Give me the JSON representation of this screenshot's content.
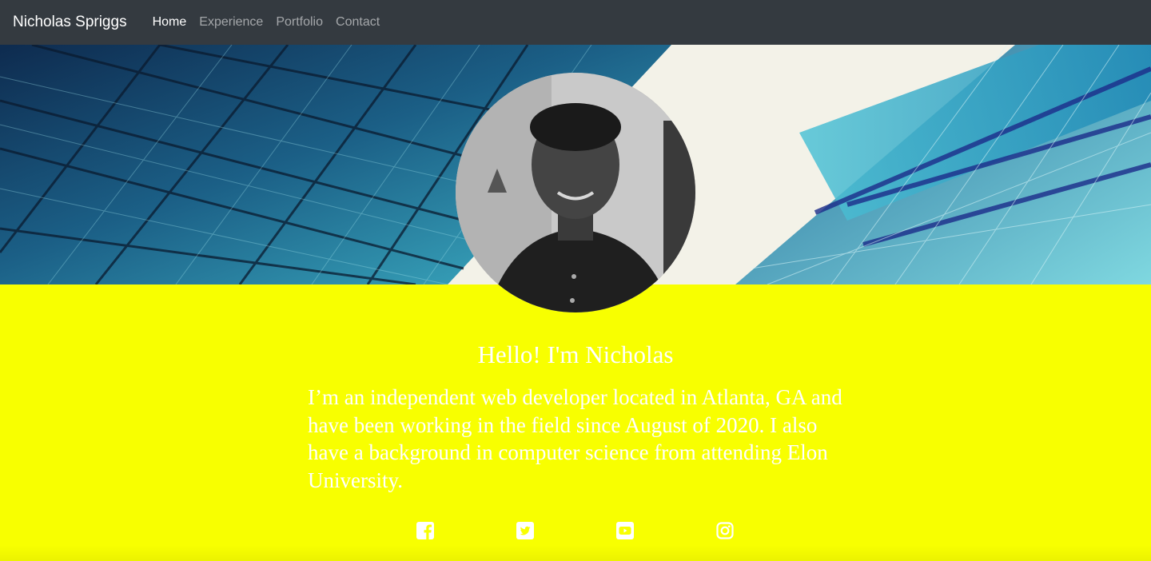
{
  "navbar": {
    "brand": "Nicholas Spriggs",
    "links": [
      {
        "label": "Home",
        "active": true
      },
      {
        "label": "Experience",
        "active": false
      },
      {
        "label": "Portfolio",
        "active": false
      },
      {
        "label": "Contact",
        "active": false
      }
    ]
  },
  "hero": {
    "greeting": "Hello! I'm Nicholas",
    "bio": "I’m an independent web developer located in Atlanta, GA and have been working in the field since August of 2020. I also have a background in computer science from attending Elon University."
  },
  "socials": [
    {
      "icon": "facebook-icon"
    },
    {
      "icon": "twitter-icon"
    },
    {
      "icon": "youtube-icon"
    },
    {
      "icon": "instagram-icon"
    }
  ],
  "colors": {
    "navbar_bg": "#343a40",
    "accent_yellow": "#f8ff00",
    "text_light": "#ffffff"
  }
}
